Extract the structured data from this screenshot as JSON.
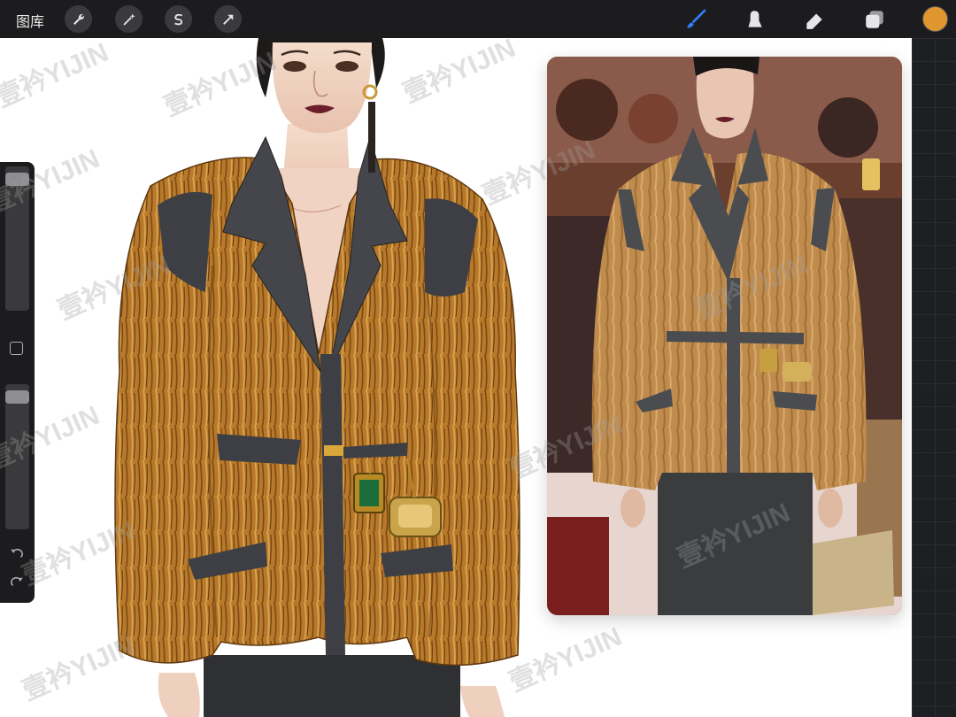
{
  "toolbar": {
    "gallery_label": "图库",
    "left_tools": [
      {
        "name": "wrench-icon",
        "label": "actions"
      },
      {
        "name": "magic-wand-icon",
        "label": "adjustments"
      },
      {
        "name": "selection-s-icon",
        "label": "selection"
      },
      {
        "name": "transform-arrow-icon",
        "label": "transform"
      }
    ],
    "right_tools": [
      {
        "name": "brush-icon",
        "active": true
      },
      {
        "name": "smudge-icon",
        "active": false
      },
      {
        "name": "eraser-icon",
        "active": false
      },
      {
        "name": "layers-icon",
        "active": false
      }
    ],
    "current_color": "#e0962e",
    "active_tool_color": "#2f7cf6"
  },
  "sidebar": {
    "brush_size_level": 0.05,
    "opacity_level": 0.05,
    "modify_button": "square-modify-icon",
    "undo_icon": "undo-icon",
    "redo_icon": "redo-icon"
  },
  "watermark": "壹衿YIJIN",
  "colors": {
    "fur": "#b8792a",
    "fur_light": "#d29a45",
    "fur_dark": "#7a4a15",
    "lapel": "#3e3f44",
    "skirt": "#2f3033",
    "skin": "#f0d3c2",
    "lips": "#6a1e2a"
  }
}
